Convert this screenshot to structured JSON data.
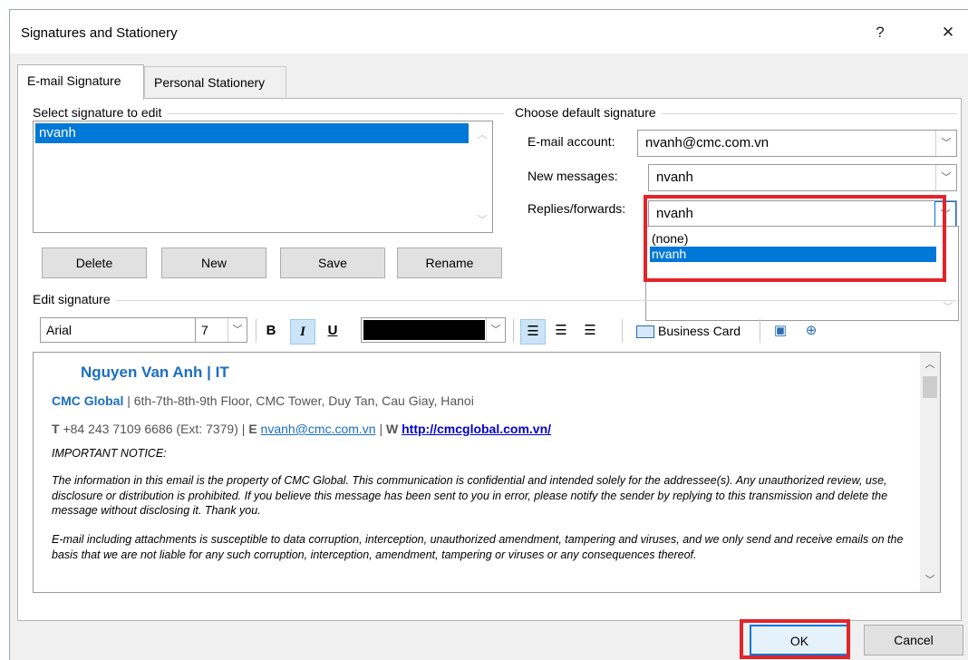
{
  "window": {
    "title": "Signatures and Stationery",
    "help": "?",
    "close": "✕"
  },
  "tabs": [
    {
      "label": "E-mail Signature"
    },
    {
      "label": "Personal Stationery"
    }
  ],
  "select_section": {
    "title": "Select signature to edit",
    "items": [
      "nvanh"
    ]
  },
  "sig_buttons": {
    "delete": "Delete",
    "new": "New",
    "save": "Save",
    "rename": "Rename"
  },
  "defaults": {
    "title": "Choose default signature",
    "email_account_label": "E-mail account:",
    "email_account_value": "nvanh@cmc.com.vn",
    "new_messages_label": "New messages:",
    "new_messages_value": "nvanh",
    "replies_label": "Replies/forwards:",
    "replies_value": "nvanh",
    "options": [
      "(none)",
      "nvanh"
    ]
  },
  "edit_section": {
    "title": "Edit signature"
  },
  "toolbar": {
    "font": "Arial",
    "size": "7",
    "bold": "B",
    "italic": "I",
    "underline": "U",
    "business_card": "Business Card",
    "color": "#000000"
  },
  "signature": {
    "name": "Nguyen Van Anh | IT",
    "company": "CMC Global",
    "address": " | 6th-7th-8th-9th Floor, CMC Tower, Duy Tan, Cau Giay, Hanoi",
    "phone_label": "T",
    "phone": " +84 243 7109 6686 (Ext: 7379) | ",
    "email_label": "E",
    "email": "nvanh@cmc.com.vn",
    "web_sep": " | ",
    "web_label": "W",
    "web": "http://cmcglobal.com.vn/",
    "notice_title": "IMPORTANT NOTICE:",
    "notice_p1": "The information in this email is the property of CMC Global. This communication is confidential and intended solely for the addressee(s). Any unauthorized review, use, disclosure or distribution is prohibited. If you believe this message has been sent to you in error, please notify the sender by replying to this transmission and delete the message without disclosing it. Thank you.",
    "notice_p2": "E-mail including attachments is susceptible to data corruption, interception, unauthorized amendment, tampering and viruses, and we only send and receive emails on the basis that we are not liable for any such corruption, interception, amendment, tampering or viruses or any consequences thereof."
  },
  "footer": {
    "ok": "OK",
    "cancel": "Cancel"
  },
  "colors": {
    "highlight": "#0078d7",
    "annotation": "#e3242b",
    "name": "#1b6ec2"
  }
}
